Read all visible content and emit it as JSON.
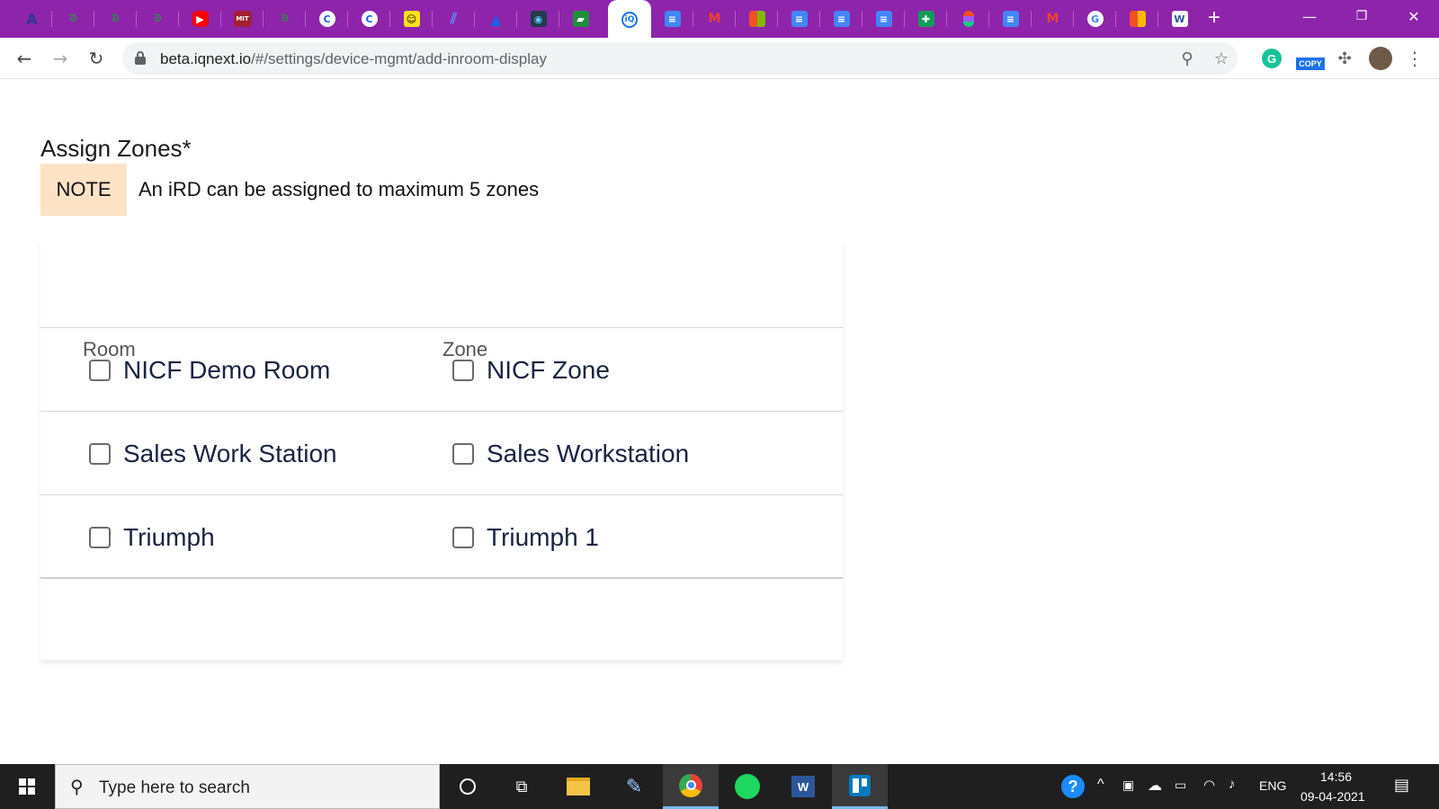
{
  "browser": {
    "url_host": "beta.iqnext.io",
    "url_path": "/#/settings/device-mgmt/add-inroom-display",
    "copy_badge": "COPY"
  },
  "content": {
    "section_title": "Assign Zones*",
    "note_label": "NOTE",
    "note_text": "An iRD can be assigned to maximum 5 zones",
    "columns": [
      "Room",
      "Zone"
    ],
    "rows": [
      {
        "room": "NICF Demo Room",
        "zone": "NICF Zone"
      },
      {
        "room": "Sales Work Station",
        "zone": "Sales Workstation"
      },
      {
        "room": "Triumph",
        "zone": "Triumph 1"
      }
    ]
  },
  "taskbar": {
    "search_placeholder": "Type here to search",
    "language": "ENG",
    "time": "14:56",
    "date": "09-04-2021"
  },
  "colors": {
    "tabstrip": "#8e24aa",
    "note_bg": "#fde3c6",
    "text_dark": "#1a2340",
    "taskbar": "#1f1f1f"
  }
}
